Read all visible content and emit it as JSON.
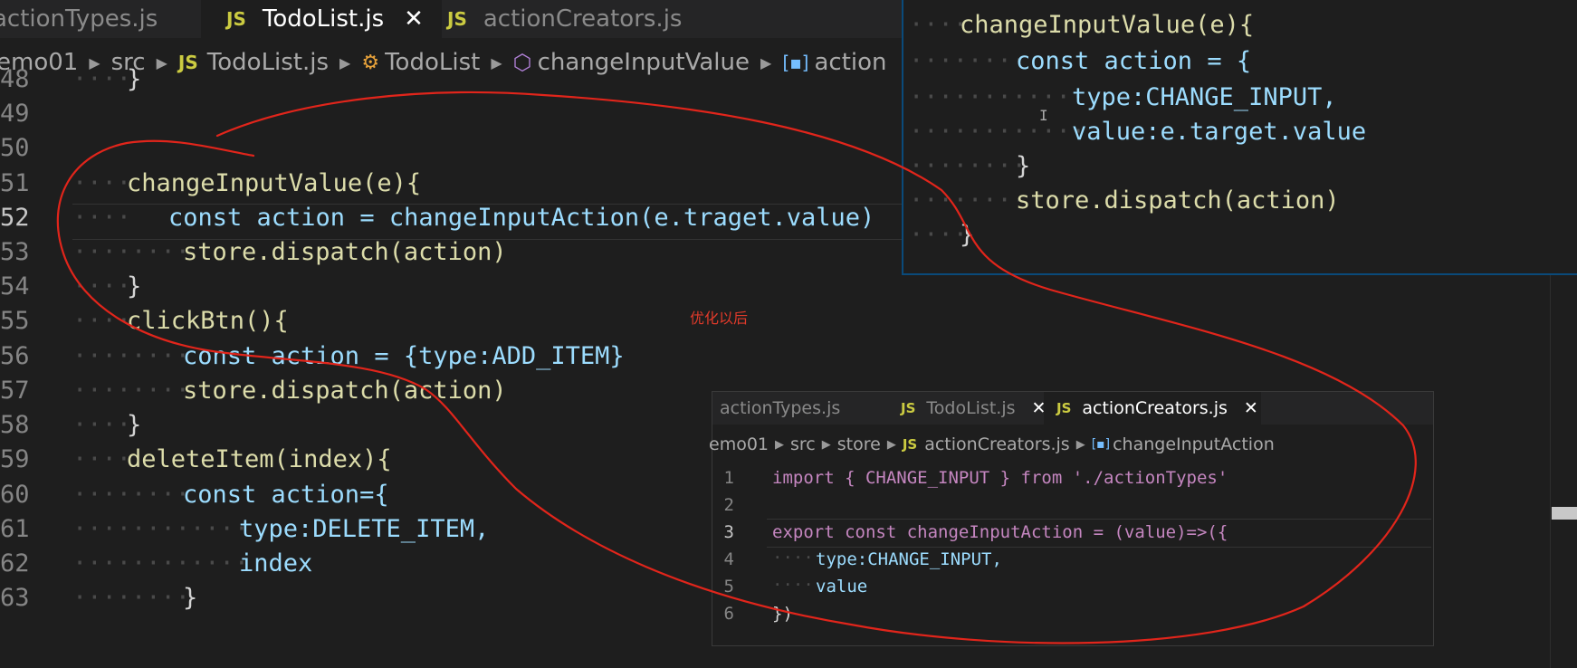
{
  "main_tabs": [
    {
      "label": "actionTypes.js",
      "active": false,
      "icon": "js-icon"
    },
    {
      "label": "TodoList.js",
      "active": true,
      "icon": "js-icon",
      "close": "✕"
    },
    {
      "label": "actionCreators.js",
      "active": false,
      "icon": "js-icon"
    }
  ],
  "js_badge": "JS",
  "breadcrumb": [
    "emo01",
    "src",
    "TodoList.js",
    "TodoList",
    "changeInputValue",
    "action"
  ],
  "code_lines": [
    {
      "n": "48",
      "text": "}"
    },
    {
      "n": "49",
      "text": ""
    },
    {
      "n": "50",
      "text": ""
    },
    {
      "n": "51",
      "text": "changeInputValue(e){"
    },
    {
      "n": "52",
      "text": "const action = changeInputAction(e.traget.value)"
    },
    {
      "n": "53",
      "text": "store.dispatch(action)"
    },
    {
      "n": "54",
      "text": "}"
    },
    {
      "n": "55",
      "text": "clickBtn(){"
    },
    {
      "n": "56",
      "text": "const action = {type:ADD_ITEM}"
    },
    {
      "n": "57",
      "text": "store.dispatch(action)"
    },
    {
      "n": "58",
      "text": "}"
    },
    {
      "n": "59",
      "text": "deleteItem(index){"
    },
    {
      "n": "60",
      "text": "const action={"
    },
    {
      "n": "61",
      "text": "type:DELETE_ITEM,"
    },
    {
      "n": "62",
      "text": "index"
    },
    {
      "n": "63",
      "text": "}"
    }
  ],
  "top_panel_lines": [
    "changeInputValue(e){",
    "const action = {",
    "type:CHANGE_INPUT,",
    "value:e.target.value",
    "}",
    "store.dispatch(action)",
    "}"
  ],
  "annotation": "优化以后",
  "bottom_panel": {
    "tabs": [
      {
        "label": "actionTypes.js",
        "active": false
      },
      {
        "label": "TodoList.js",
        "active": false,
        "close": "✕"
      },
      {
        "label": "actionCreators.js",
        "active": true,
        "close": "✕"
      }
    ],
    "breadcrumb": [
      "emo01",
      "src",
      "store",
      "actionCreators.js",
      "changeInputAction"
    ],
    "lines": [
      {
        "n": "1",
        "text": "import { CHANGE_INPUT } from './actionTypes'"
      },
      {
        "n": "2",
        "text": ""
      },
      {
        "n": "3",
        "text": "export const changeInputAction = (value)=>({"
      },
      {
        "n": "4",
        "text": "type:CHANGE_INPUT,"
      },
      {
        "n": "5",
        "text": "value"
      },
      {
        "n": "6",
        "text": "})"
      }
    ]
  },
  "colors": {
    "background": "#1e1e1e",
    "keyword": "#569cd6",
    "function": "#dcdcaa",
    "variable": "#9cdcfe",
    "annotation_red": "#e03a2a"
  }
}
